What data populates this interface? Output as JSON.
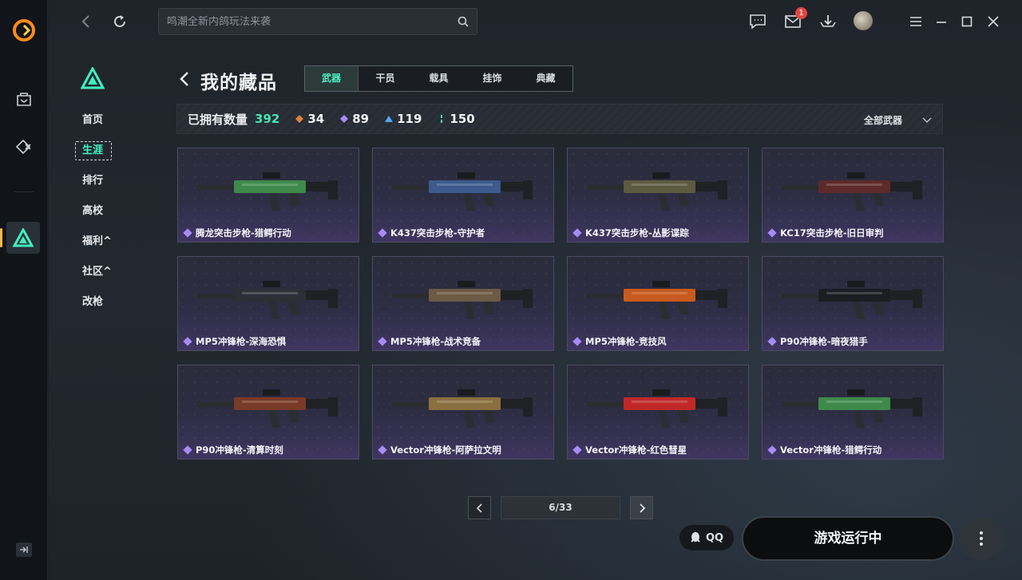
{
  "window": {
    "search_placeholder": "鸣潮全新内鸽玩法来袭",
    "notification_count": "1"
  },
  "sidenav": {
    "items": [
      {
        "label": "首页"
      },
      {
        "label": "生涯",
        "active": true
      },
      {
        "label": "排行"
      },
      {
        "label": "高校"
      },
      {
        "label": "福利^"
      },
      {
        "label": "社区^"
      },
      {
        "label": "改枪"
      }
    ]
  },
  "page": {
    "title": "我的藏品",
    "tabs": [
      "武器",
      "干员",
      "载具",
      "挂饰",
      "典藏"
    ],
    "active_tab": "武器"
  },
  "stats": {
    "owned_label": "已拥有数量",
    "owned_count": "392",
    "gold": {
      "value": "34",
      "color": "#e0823a"
    },
    "purple": {
      "value": "89",
      "color": "#a78bfa"
    },
    "blue": {
      "value": "119",
      "color": "#4ea8ff"
    },
    "green": {
      "value": "150",
      "color": "#3fd6a8"
    },
    "filter_label": "全部武器"
  },
  "cards": [
    {
      "label": "腾龙突击步枪-猎鳄行动",
      "accent": "#3f8a4a"
    },
    {
      "label": "K437突击步枪-守护者",
      "accent": "#3c5a8c"
    },
    {
      "label": "K437突击步枪-丛影谍踪",
      "accent": "#5d5a40"
    },
    {
      "label": "KC17突击步枪-旧日审判",
      "accent": "#5d2a2a"
    },
    {
      "label": "MP5冲锋枪-深海恐惧",
      "accent": "#2c2f35"
    },
    {
      "label": "MP5冲锋枪-战术竞备",
      "accent": "#6d5a45"
    },
    {
      "label": "MP5冲锋枪-竞技风",
      "accent": "#c85a1e"
    },
    {
      "label": "P90冲锋枪-暗夜猎手",
      "accent": "#1c1d22"
    },
    {
      "label": "P90冲锋枪-清算时刻",
      "accent": "#7a3a28"
    },
    {
      "label": "Vector冲锋枪-阿萨拉文明",
      "accent": "#8a7040"
    },
    {
      "label": "Vector冲锋枪-红色彗星",
      "accent": "#c02828"
    },
    {
      "label": "Vector冲锋枪-猎鳄行动",
      "accent": "#3f8a4a"
    }
  ],
  "pager": {
    "page": "6/33"
  },
  "footer": {
    "qq_label": "QQ",
    "launch_label": "游戏运行中"
  }
}
